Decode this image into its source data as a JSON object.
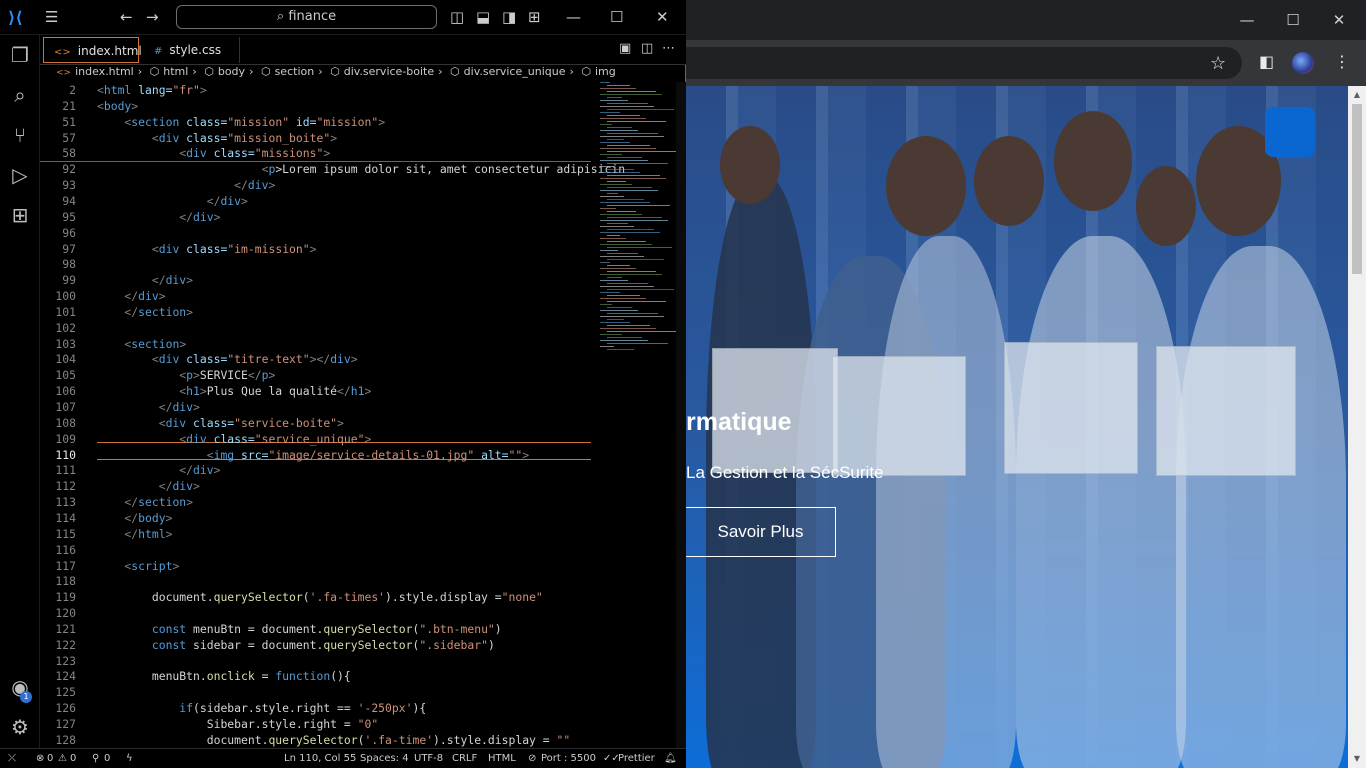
{
  "editor": {
    "search_text": "finance",
    "tabs": [
      {
        "label": "index.html",
        "active": true
      },
      {
        "label": "style.css",
        "active": false
      }
    ],
    "breadcrumb": [
      "index.html",
      "html",
      "body",
      "section",
      "div.service-boite",
      "div.service_unique",
      "img"
    ],
    "lines": [
      {
        "n": "2",
        "t": [
          [
            "<",
            "brk"
          ],
          [
            "html ",
            "tag"
          ],
          [
            "lang=",
            "attr"
          ],
          [
            "\"fr\"",
            "str"
          ],
          [
            ">",
            "brk"
          ]
        ]
      },
      {
        "n": "21",
        "t": [
          [
            "<",
            "brk"
          ],
          [
            "body",
            "tag"
          ],
          [
            ">",
            "brk"
          ]
        ]
      },
      {
        "n": "51",
        "t": [
          [
            "    <",
            "brk"
          ],
          [
            "section ",
            "tag"
          ],
          [
            "class=",
            "attr"
          ],
          [
            "\"mission\" ",
            "str"
          ],
          [
            "id=",
            "attr"
          ],
          [
            "\"mission\"",
            "str"
          ],
          [
            ">",
            "brk"
          ]
        ]
      },
      {
        "n": "57",
        "t": [
          [
            "        <",
            "brk"
          ],
          [
            "div ",
            "tag"
          ],
          [
            "class=",
            "attr"
          ],
          [
            "\"mission_boite\"",
            "str"
          ],
          [
            ">",
            "brk"
          ]
        ]
      },
      {
        "n": "58",
        "t": [
          [
            "            <",
            "brk"
          ],
          [
            "div ",
            "tag"
          ],
          [
            "class=",
            "attr"
          ],
          [
            "\"missions\"",
            "str"
          ],
          [
            ">",
            "brk"
          ]
        ]
      },
      {
        "n": "92",
        "t": [
          [
            "                        <",
            "brk"
          ],
          [
            "p",
            "tag"
          ],
          [
            ">Lorem ipsum dolor sit, amet consectetur adipisicin",
            "txt"
          ]
        ]
      },
      {
        "n": "93",
        "t": [
          [
            "                    </",
            "brk"
          ],
          [
            "div",
            "tag"
          ],
          [
            ">",
            "brk"
          ]
        ]
      },
      {
        "n": "94",
        "t": [
          [
            "                </",
            "brk"
          ],
          [
            "div",
            "tag"
          ],
          [
            ">",
            "brk"
          ]
        ]
      },
      {
        "n": "95",
        "t": [
          [
            "            </",
            "brk"
          ],
          [
            "div",
            "tag"
          ],
          [
            ">",
            "brk"
          ]
        ]
      },
      {
        "n": "96",
        "t": []
      },
      {
        "n": "97",
        "t": [
          [
            "        <",
            "brk"
          ],
          [
            "div ",
            "tag"
          ],
          [
            "class=",
            "attr"
          ],
          [
            "\"im-mission\"",
            "str"
          ],
          [
            ">",
            "brk"
          ]
        ]
      },
      {
        "n": "98",
        "t": []
      },
      {
        "n": "99",
        "t": [
          [
            "        </",
            "brk"
          ],
          [
            "div",
            "tag"
          ],
          [
            ">",
            "brk"
          ]
        ]
      },
      {
        "n": "100",
        "t": [
          [
            "    </",
            "brk"
          ],
          [
            "div",
            "tag"
          ],
          [
            ">",
            "brk"
          ]
        ]
      },
      {
        "n": "101",
        "t": [
          [
            "    </",
            "brk"
          ],
          [
            "section",
            "tag"
          ],
          [
            ">",
            "brk"
          ]
        ]
      },
      {
        "n": "102",
        "t": []
      },
      {
        "n": "103",
        "t": [
          [
            "    <",
            "brk"
          ],
          [
            "section",
            "tag"
          ],
          [
            ">",
            "brk"
          ]
        ]
      },
      {
        "n": "104",
        "t": [
          [
            "        <",
            "brk"
          ],
          [
            "div ",
            "tag"
          ],
          [
            "class=",
            "attr"
          ],
          [
            "\"titre-text\"",
            "str"
          ],
          [
            "></",
            "brk"
          ],
          [
            "div",
            "tag"
          ],
          [
            ">",
            "brk"
          ]
        ]
      },
      {
        "n": "105",
        "t": [
          [
            "            <",
            "brk"
          ],
          [
            "p",
            "tag"
          ],
          [
            ">",
            "brk"
          ],
          [
            "SERVICE",
            "txt"
          ],
          [
            "</",
            "brk"
          ],
          [
            "p",
            "tag"
          ],
          [
            ">",
            "brk"
          ]
        ]
      },
      {
        "n": "106",
        "t": [
          [
            "            <",
            "brk"
          ],
          [
            "h1",
            "tag"
          ],
          [
            ">",
            "brk"
          ],
          [
            "Plus Que la qualité",
            "txt"
          ],
          [
            "</",
            "brk"
          ],
          [
            "h1",
            "tag"
          ],
          [
            ">",
            "brk"
          ]
        ]
      },
      {
        "n": "107",
        "t": [
          [
            "         </",
            "brk"
          ],
          [
            "div",
            "tag"
          ],
          [
            ">",
            "brk"
          ]
        ]
      },
      {
        "n": "108",
        "t": [
          [
            "         <",
            "brk"
          ],
          [
            "div ",
            "tag"
          ],
          [
            "class=",
            "attr"
          ],
          [
            "\"service-boite\"",
            "str"
          ],
          [
            ">",
            "brk"
          ]
        ]
      },
      {
        "n": "109",
        "t": [
          [
            "            <",
            "brk"
          ],
          [
            "div ",
            "tag"
          ],
          [
            "class=",
            "attr"
          ],
          [
            "\"service_unique\"",
            "str"
          ],
          [
            ">",
            "brk"
          ]
        ]
      },
      {
        "n": "110",
        "t": [
          [
            "                <",
            "brk"
          ],
          [
            "img ",
            "tag"
          ],
          [
            "src=",
            "attr"
          ],
          [
            "\"image/service-details-01.jpg\" ",
            "str"
          ],
          [
            "alt=",
            "attr"
          ],
          [
            "\"\"",
            "str"
          ],
          [
            ">",
            "brk"
          ]
        ]
      },
      {
        "n": "111",
        "t": [
          [
            "            </",
            "brk"
          ],
          [
            "div",
            "tag"
          ],
          [
            ">",
            "brk"
          ]
        ]
      },
      {
        "n": "112",
        "t": [
          [
            "         </",
            "brk"
          ],
          [
            "div",
            "tag"
          ],
          [
            ">",
            "brk"
          ]
        ]
      },
      {
        "n": "113",
        "t": [
          [
            "    </",
            "brk"
          ],
          [
            "section",
            "tag"
          ],
          [
            ">",
            "brk"
          ]
        ]
      },
      {
        "n": "114",
        "t": [
          [
            "    </",
            "brk"
          ],
          [
            "body",
            "tag"
          ],
          [
            ">",
            "brk"
          ]
        ]
      },
      {
        "n": "115",
        "t": [
          [
            "    </",
            "brk"
          ],
          [
            "html",
            "tag"
          ],
          [
            ">",
            "brk"
          ]
        ]
      },
      {
        "n": "116",
        "t": []
      },
      {
        "n": "117",
        "t": [
          [
            "    <",
            "brk"
          ],
          [
            "script",
            "tag"
          ],
          [
            ">",
            "brk"
          ]
        ]
      },
      {
        "n": "118",
        "t": []
      },
      {
        "n": "119",
        "t": [
          [
            "        document.",
            "txt"
          ],
          [
            "querySelector",
            "fn"
          ],
          [
            "(",
            "txt"
          ],
          [
            "'.fa-times'",
            "str"
          ],
          [
            ").style.display =",
            "txt"
          ],
          [
            "\"none\"",
            "str"
          ]
        ]
      },
      {
        "n": "120",
        "t": []
      },
      {
        "n": "121",
        "t": [
          [
            "        ",
            "txt"
          ],
          [
            "const ",
            "kw"
          ],
          [
            "menuBtn = document.",
            "txt"
          ],
          [
            "querySelector",
            "fn"
          ],
          [
            "(",
            "txt"
          ],
          [
            "\".btn-menu\"",
            "str"
          ],
          [
            ")",
            "txt"
          ]
        ]
      },
      {
        "n": "122",
        "t": [
          [
            "        ",
            "txt"
          ],
          [
            "const ",
            "kw"
          ],
          [
            "sidebar = document.",
            "txt"
          ],
          [
            "querySelector",
            "fn"
          ],
          [
            "(",
            "txt"
          ],
          [
            "\".sidebar\"",
            "str"
          ],
          [
            ")",
            "txt"
          ]
        ]
      },
      {
        "n": "123",
        "t": []
      },
      {
        "n": "124",
        "t": [
          [
            "        menuBtn.",
            "txt"
          ],
          [
            "onclick",
            "fn"
          ],
          [
            " = ",
            "txt"
          ],
          [
            "function",
            "kw"
          ],
          [
            "(){",
            "txt"
          ]
        ]
      },
      {
        "n": "125",
        "t": []
      },
      {
        "n": "126",
        "t": [
          [
            "            ",
            "txt"
          ],
          [
            "if",
            "kw"
          ],
          [
            "(sidebar.style.right == ",
            "txt"
          ],
          [
            "'-250px'",
            "str"
          ],
          [
            "){",
            "txt"
          ]
        ]
      },
      {
        "n": "127",
        "t": [
          [
            "                Sibebar.style.right = ",
            "txt"
          ],
          [
            "\"0\"",
            "str"
          ]
        ]
      },
      {
        "n": "128",
        "t": [
          [
            "                document.",
            "txt"
          ],
          [
            "querySelector",
            "fn"
          ],
          [
            "(",
            "txt"
          ],
          [
            "'.fa-time'",
            "str"
          ],
          [
            ").style.display = ",
            "txt"
          ],
          [
            "\"\"",
            "str"
          ]
        ]
      }
    ],
    "status": {
      "errors": "0",
      "warnings": "0",
      "ports": "0",
      "position": "Ln 110, Col 55",
      "spaces": "Spaces: 4",
      "encoding": "UTF-8",
      "eol": "CRLF",
      "language": "HTML",
      "port": "Port : 5500",
      "prettier": "Prettier"
    },
    "accounts_badge": "1"
  },
  "browser": {
    "hero_title": "rmatique",
    "hero_subtitle": "La Gestion et la SécSurite",
    "hero_button": "Savoir Plus",
    "accent_color": "#0a67d1"
  }
}
